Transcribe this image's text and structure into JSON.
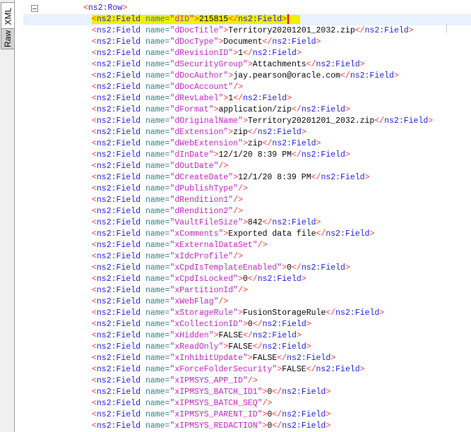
{
  "tabs": {
    "xml": "XML",
    "raw": "Raw"
  },
  "editor": {
    "row_tag": "ns2:Row",
    "field_tag": "ns2:Field",
    "attr_name": "name",
    "fields": [
      {
        "name": "dID",
        "value": "215815"
      },
      {
        "name": "dDocTitle",
        "value": "Territory20201201_2032.zip"
      },
      {
        "name": "dDocType",
        "value": "Document"
      },
      {
        "name": "dRevisionID",
        "value": "1"
      },
      {
        "name": "dSecurityGroup",
        "value": "Attachments"
      },
      {
        "name": "dDocAuthor",
        "value": "jay.pearson@oracle.com"
      },
      {
        "name": "dDocAccount",
        "value": null
      },
      {
        "name": "dRevLabel",
        "value": "1"
      },
      {
        "name": "dFormat",
        "value": "application/zip"
      },
      {
        "name": "dOriginalName",
        "value": "Territory20201201_2032.zip"
      },
      {
        "name": "dExtension",
        "value": "zip"
      },
      {
        "name": "dWebExtension",
        "value": "zip"
      },
      {
        "name": "dInDate",
        "value": "12/1/20 8:39 PM"
      },
      {
        "name": "dOutDate",
        "value": null
      },
      {
        "name": "dCreateDate",
        "value": "12/1/20 8:39 PM"
      },
      {
        "name": "dPublishType",
        "value": null
      },
      {
        "name": "dRendition1",
        "value": null
      },
      {
        "name": "dRendition2",
        "value": null
      },
      {
        "name": "VaultFileSize",
        "value": "842"
      },
      {
        "name": "xComments",
        "value": "Exported data file"
      },
      {
        "name": "xExternalDataSet",
        "value": null
      },
      {
        "name": "xIdcProfile",
        "value": null
      },
      {
        "name": "xCpdIsTemplateEnabled",
        "value": "0"
      },
      {
        "name": "xCpdIsLocked",
        "value": "0"
      },
      {
        "name": "xPartitionId",
        "value": null
      },
      {
        "name": "xWebFlag",
        "value": null
      },
      {
        "name": "xStorageRule",
        "value": "FusionStorageRule"
      },
      {
        "name": "xCollectionID",
        "value": "0"
      },
      {
        "name": "xHidden",
        "value": "FALSE"
      },
      {
        "name": "xReadOnly",
        "value": "FALSE"
      },
      {
        "name": "xInhibitUpdate",
        "value": "FALSE"
      },
      {
        "name": "xForceFolderSecurity",
        "value": "FALSE"
      },
      {
        "name": "xIPMSYS_APP_ID",
        "value": null
      },
      {
        "name": "xIPMSYS_BATCH_ID1",
        "value": "0"
      },
      {
        "name": "xIPMSYS_BATCH_SEQ",
        "value": null
      },
      {
        "name": "xIPMSYS_PARENT_ID",
        "value": "0"
      },
      {
        "name": "xIPMSYS_REDACTION",
        "value": "0"
      }
    ]
  },
  "colors": {
    "bracket": "#ff3030",
    "tag": "#1a1ae0",
    "attr": "#2f7f7f",
    "value": "#c020c0",
    "highlight": "#f0f000",
    "current_line": "#e8f2fe"
  }
}
